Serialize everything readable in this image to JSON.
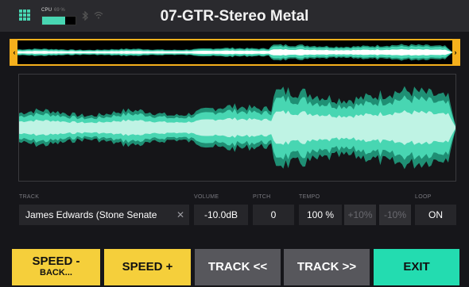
{
  "header": {
    "title": "07-GTR-Stereo Metal",
    "cpu_label": "CPU",
    "cpu_percent": "69 %",
    "cpu_load": 0.69,
    "icons": [
      "grid-menu-icon",
      "bluetooth-icon",
      "wifi-icon"
    ]
  },
  "colors": {
    "accent_green": "#48d6b2",
    "overview_border": "#f5b01c",
    "button_yellow": "#f5cf3b",
    "button_gray": "#57575c",
    "button_green": "#23dcb0"
  },
  "params": {
    "track_label": "TRACK",
    "track_value": "James Edwards (Stone Senate",
    "volume_label": "VOLUME",
    "volume_value": "-10.0dB",
    "pitch_label": "PITCH",
    "pitch_value": "0",
    "tempo_label": "TEMPO",
    "tempo_value": "100 %",
    "tempo_plus": "+10%",
    "tempo_minus": "-10%",
    "loop_label": "LOOP",
    "loop_value": "ON"
  },
  "buttons": {
    "speed_back_line1": "SPEED -",
    "speed_back_line2": "BACK...",
    "speed_plus": "SPEED +",
    "track_prev": "TRACK <<",
    "track_next": "TRACK >>",
    "exit": "EXIT"
  }
}
